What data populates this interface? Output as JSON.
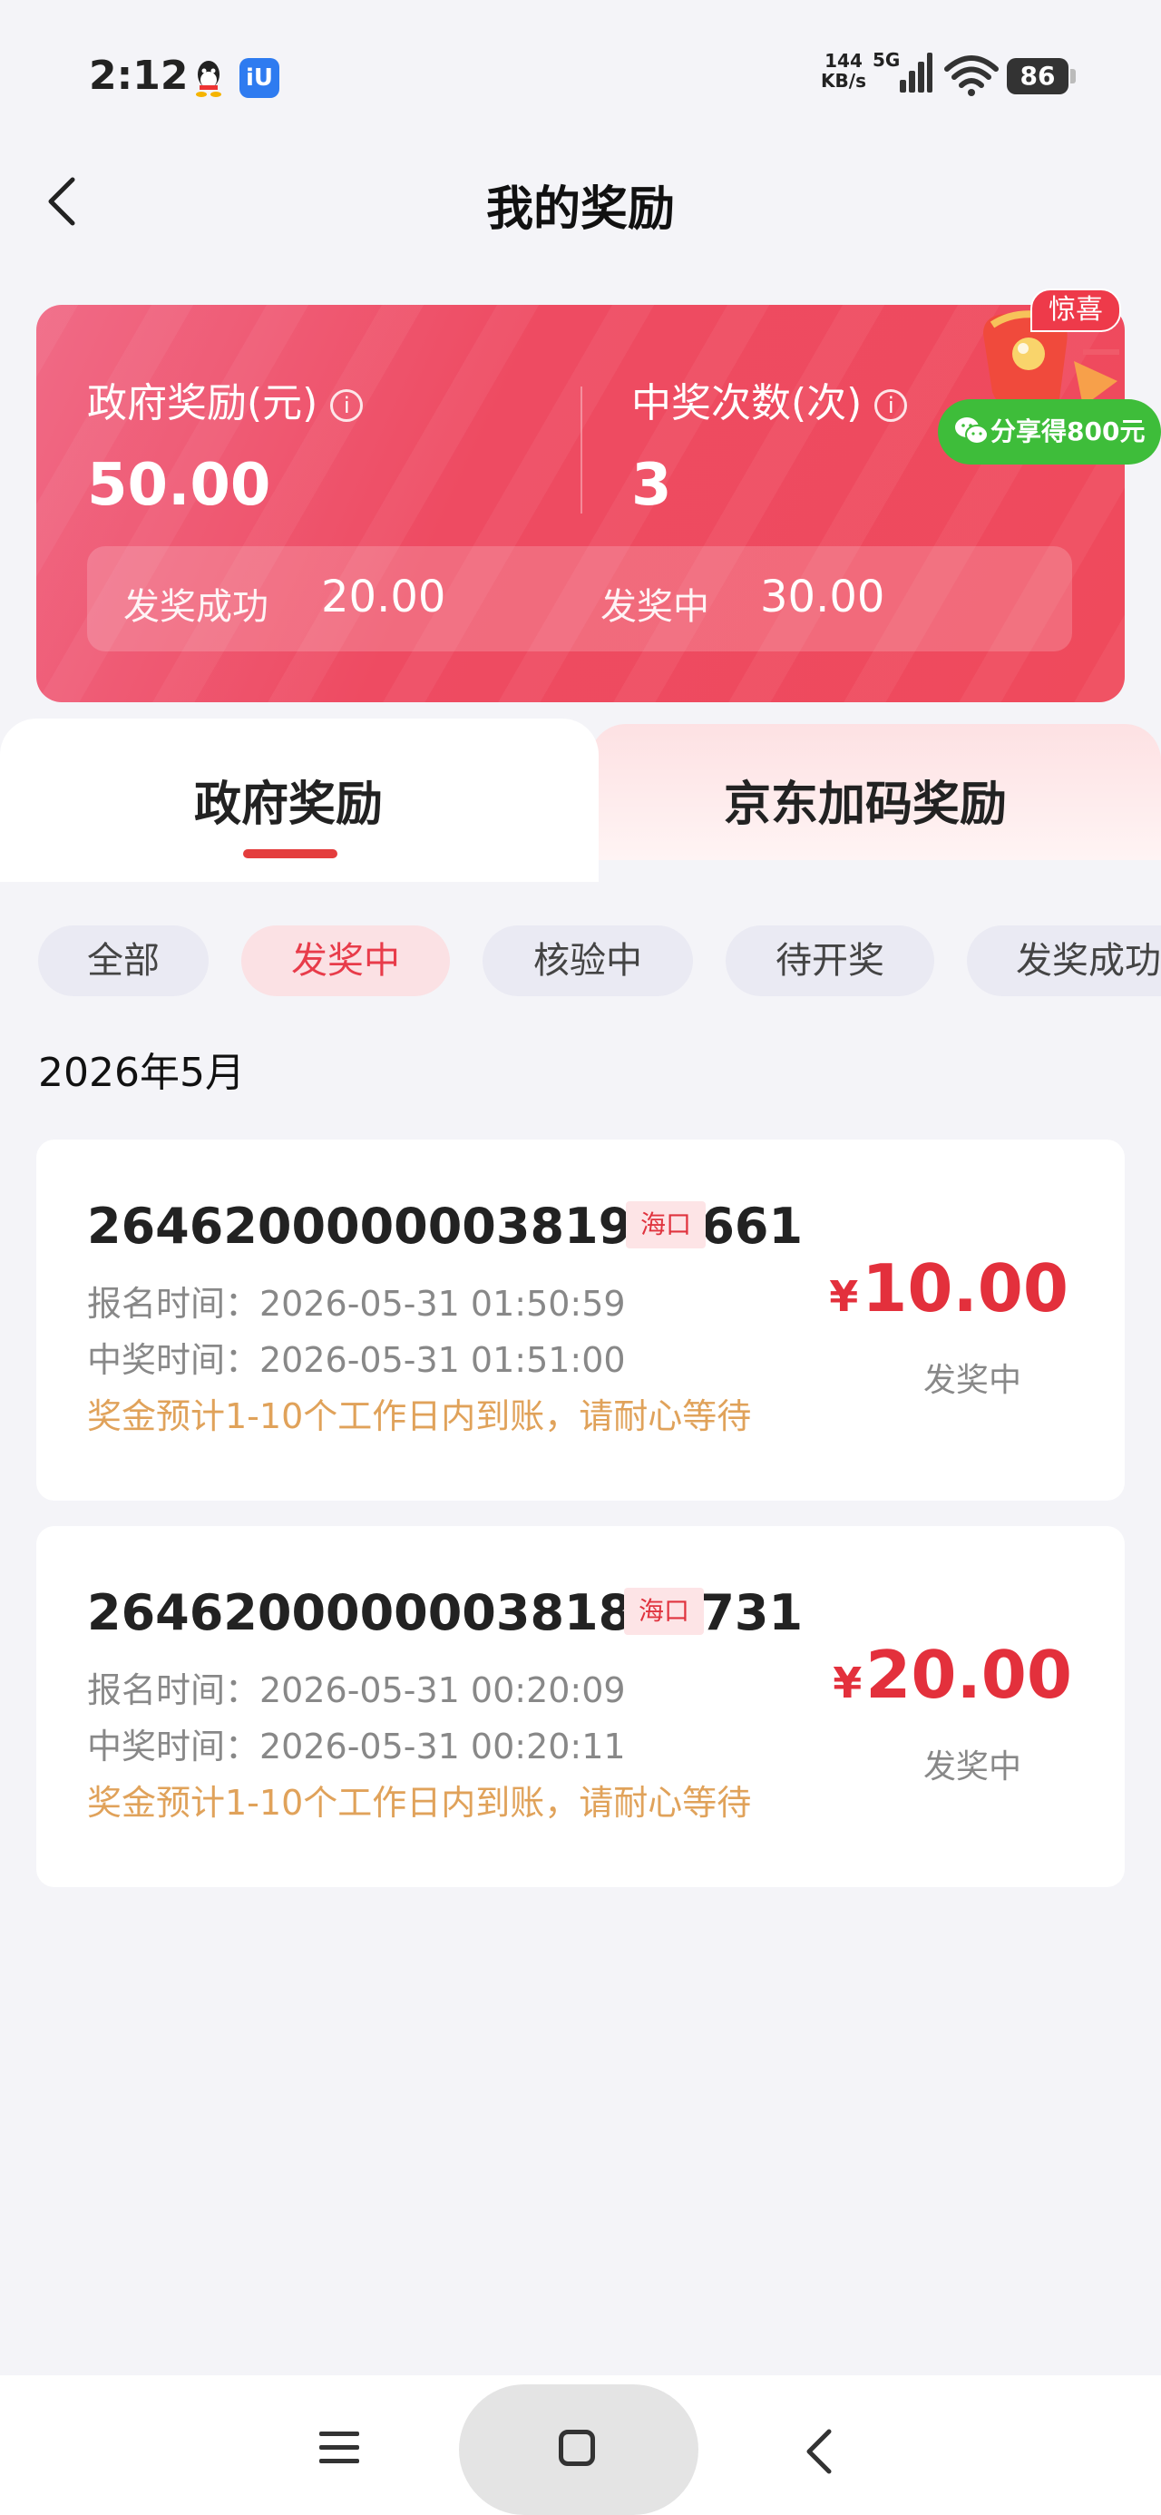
{
  "status_bar": {
    "time": "2:12",
    "net_speed_value": "144",
    "net_speed_unit": "KB/s",
    "network_type": "5G",
    "battery": "86",
    "icons": [
      "qq-icon",
      "app-icon",
      "signal-icon",
      "wifi-icon",
      "battery-icon"
    ]
  },
  "header": {
    "title": "我的奖励",
    "back_icon": "chevron-left-icon"
  },
  "summary": {
    "gov_reward_label": "政府奖励(元)",
    "gov_reward_value": "50.00",
    "win_count_label": "中奖次数(次)",
    "win_count_value": "3",
    "paid_label": "发奖成功",
    "paid_value": "20.00",
    "paying_label": "发奖中",
    "paying_value": "30.00"
  },
  "promo": {
    "tag": "惊喜",
    "share_button": "分享得800元"
  },
  "tabs": [
    {
      "label": "政府奖励",
      "active": true
    },
    {
      "label": "京东加码奖励",
      "active": false
    }
  ],
  "filters": [
    {
      "label": "全部",
      "active": false
    },
    {
      "label": "发奖中",
      "active": true
    },
    {
      "label": "核验中",
      "active": false
    },
    {
      "label": "待开奖",
      "active": false
    },
    {
      "label": "发奖成功",
      "active": false
    }
  ],
  "month": "2026年5月",
  "records": [
    {
      "id": "264620000000381963661",
      "city": "海口",
      "signup": "报名时间：2026-05-31 01:50:59",
      "win": "中奖时间：2026-05-31 01:51:00",
      "note": "奖金预计1-10个工作日内到账，请耐心等待",
      "currency": "¥",
      "amount": "10.00",
      "status": "发奖中"
    },
    {
      "id": "264620000000381806731",
      "city": "海口",
      "signup": "报名时间：2026-05-31 00:20:09",
      "win": "中奖时间：2026-05-31 00:20:11",
      "note": "奖金预计1-10个工作日内到账，请耐心等待",
      "currency": "¥",
      "amount": "20.00",
      "status": "发奖中"
    }
  ],
  "colors": {
    "accent": "#e3303c",
    "card_gradient_start": "#f06a86",
    "card_gradient_end": "#ef4a5c",
    "note": "#e0a25a",
    "share_green": "#3ebd3a"
  },
  "nav": {
    "icons": [
      "menu-icon",
      "home-icon",
      "back-icon"
    ]
  }
}
